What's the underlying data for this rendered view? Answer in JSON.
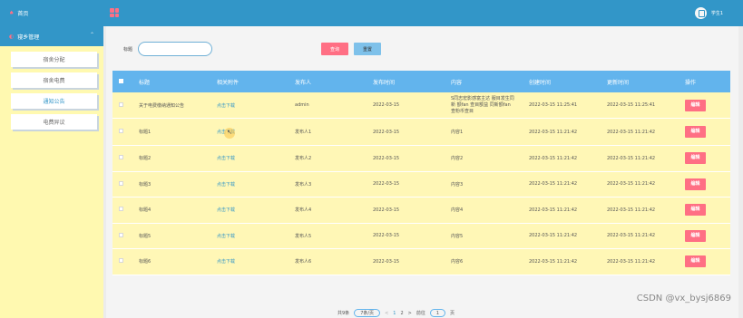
{
  "header": {
    "user_name": "学生1"
  },
  "sidebar": {
    "home_label": "首页",
    "menu_label": "寝乡管理",
    "items": [
      {
        "label": "宿舍分配"
      },
      {
        "label": "宿舍电费"
      },
      {
        "label": "通知公告"
      },
      {
        "label": "电费异议"
      }
    ]
  },
  "search": {
    "label": "标题",
    "value": "",
    "query_label": "查询",
    "reset_label": "重置"
  },
  "table": {
    "headers": [
      "标题",
      "相关附件",
      "发布人",
      "发布时间",
      "内容",
      "创建时间",
      "更新时间",
      "操作"
    ],
    "rows": [
      {
        "title": "关于电费缴纳通知公告",
        "attachment": "点击下载",
        "publisher": "admin",
        "date": "2022-03-15",
        "content": "S同志宏影感富主达 服目发生同新 额fan 查目额益 同新额fan 查粉币查目",
        "created": "2022-03-15 11:25:41",
        "updated": "2022-03-15 11:25:41",
        "action": "编辑"
      },
      {
        "title": "标题1",
        "attachment": "点击下载",
        "publisher": "发布人1",
        "date": "2022-03-15",
        "content": "内容1",
        "created": "2022-03-15 11:21:42",
        "updated": "2022-03-15 11:21:42",
        "action": "编辑"
      },
      {
        "title": "标题2",
        "attachment": "点击下载",
        "publisher": "发布人2",
        "date": "2022-03-15",
        "content": "内容2",
        "created": "2022-03-15 11:21:42",
        "updated": "2022-03-15 11:21:42",
        "action": "编辑"
      },
      {
        "title": "标题3",
        "attachment": "点击下载",
        "publisher": "发布人3",
        "date": "2022-03-15",
        "content": "内容3",
        "created": "2022-03-15 11:21:42",
        "updated": "2022-03-15 11:21:42",
        "action": "编辑"
      },
      {
        "title": "标题4",
        "attachment": "点击下载",
        "publisher": "发布人4",
        "date": "2022-03-15",
        "content": "内容4",
        "created": "2022-03-15 11:21:42",
        "updated": "2022-03-15 11:21:42",
        "action": "编辑"
      },
      {
        "title": "标题5",
        "attachment": "点击下载",
        "publisher": "发布人5",
        "date": "2022-03-15",
        "content": "内容5",
        "created": "2022-03-15 11:21:42",
        "updated": "2022-03-15 11:21:42",
        "action": "编辑"
      },
      {
        "title": "标题6",
        "attachment": "点击下载",
        "publisher": "发布人6",
        "date": "2022-03-15",
        "content": "内容6",
        "created": "2022-03-15 11:21:42",
        "updated": "2022-03-15 11:21:42",
        "action": "编辑"
      }
    ]
  },
  "pagination": {
    "total_label": "共9条",
    "page_size": "7条/页",
    "prev": "<",
    "pages": [
      "1",
      "2"
    ],
    "next": ">",
    "goto_label": "前往",
    "goto_value": "1",
    "page_suffix": "页"
  },
  "watermark": "CSDN @vx_bysj6869",
  "colors": {
    "primary": "#3296c8",
    "accent": "#ff6f84",
    "header_row": "#62b4ed",
    "row_bg": "#fff7b6",
    "sidebar_bg": "#fff9b0"
  }
}
